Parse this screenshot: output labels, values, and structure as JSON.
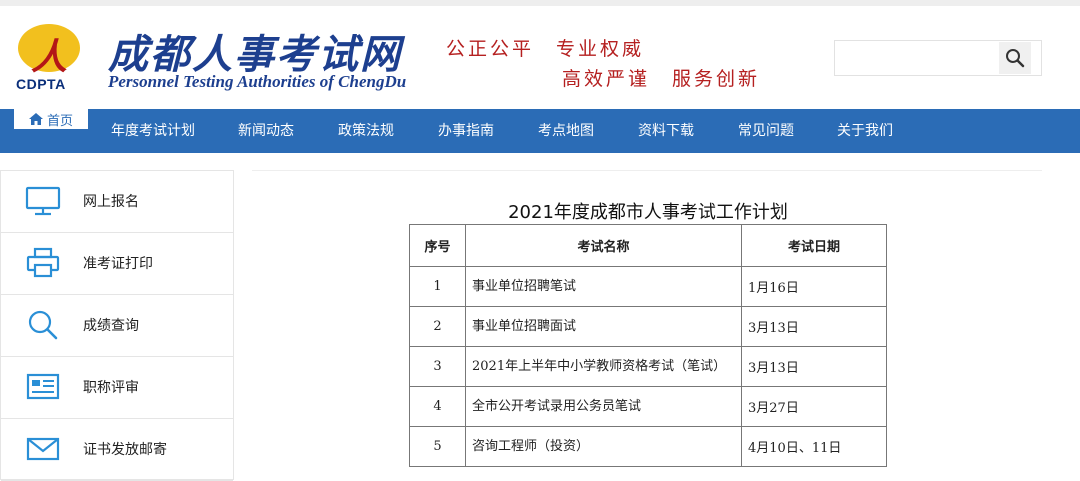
{
  "header": {
    "logo_abbr": "CDPTA",
    "logo_letter": "人",
    "brand_cn": "成都人事考试网",
    "brand_en": "Personnel Testing Authorities of ChengDu",
    "slogan_line1": "公正公平　专业权威",
    "slogan_line2": "高效严谨　服务创新",
    "search": {
      "value": "",
      "placeholder": ""
    }
  },
  "nav": {
    "home_label": "首页",
    "items": [
      {
        "label": "年度考试计划"
      },
      {
        "label": "新闻动态"
      },
      {
        "label": "政策法规"
      },
      {
        "label": "办事指南"
      },
      {
        "label": "考点地图"
      },
      {
        "label": "资料下载"
      },
      {
        "label": "常见问题"
      },
      {
        "label": "关于我们"
      }
    ]
  },
  "sidebar": {
    "items": [
      {
        "label": "网上报名",
        "icon": "monitor-icon"
      },
      {
        "label": "准考证打印",
        "icon": "printer-icon"
      },
      {
        "label": "成绩查询",
        "icon": "search-icon"
      },
      {
        "label": "职称评审",
        "icon": "id-card-icon"
      },
      {
        "label": "证书发放邮寄",
        "icon": "mail-icon"
      }
    ]
  },
  "main": {
    "title": "2021年度成都市人事考试工作计划",
    "table": {
      "headers": [
        "序号",
        "考试名称",
        "考试日期"
      ],
      "rows": [
        {
          "no": "1",
          "name": "事业单位招聘笔试",
          "date": "1月16日"
        },
        {
          "no": "2",
          "name": "事业单位招聘面试",
          "date": "3月13日"
        },
        {
          "no": "3",
          "name": "2021年上半年中小学教师资格考试（笔试）",
          "date": "3月13日"
        },
        {
          "no": "4",
          "name": "全市公开考试录用公务员笔试",
          "date": "3月27日"
        },
        {
          "no": "5",
          "name": "咨询工程师（投资）",
          "date": "4月10日、11日"
        }
      ]
    }
  },
  "colors": {
    "nav_blue": "#2b6cb6",
    "brand_blue": "#1d3f8f",
    "slogan_red": "#b52020",
    "icon_blue": "#2a8fd6"
  }
}
